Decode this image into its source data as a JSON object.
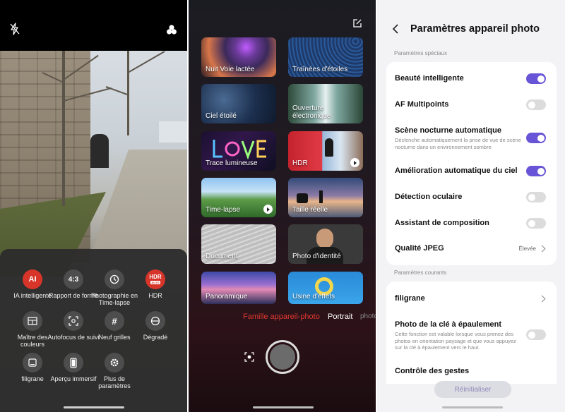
{
  "camera": {
    "icons": {
      "flash": "flash-off-icon",
      "effects": "filter-effects-icon"
    },
    "options": [
      {
        "id": "ai",
        "icon_text": "AI",
        "label": "IA intelligente",
        "active": true
      },
      {
        "id": "ratio",
        "icon_text": "4:3",
        "label": "Rapport de forme",
        "active": false
      },
      {
        "id": "timelapse",
        "icon_text": "",
        "label": "Photographie en Time-lapse",
        "active": false
      },
      {
        "id": "hdr",
        "icon_text": "HDR",
        "label": "HDR",
        "active": true,
        "badge": "AUTO"
      },
      {
        "id": "color",
        "icon_text": "",
        "label": "Maître des couleurs",
        "active": false
      },
      {
        "id": "af",
        "icon_text": "",
        "label": "Autofocus de suivi",
        "active": false
      },
      {
        "id": "grid",
        "icon_text": "",
        "label": "Neuf grilles",
        "active": false
      },
      {
        "id": "gradient",
        "icon_text": "",
        "label": "Dégradé",
        "active": false
      },
      {
        "id": "watermark",
        "icon_text": "",
        "label": "filigrane",
        "active": false
      },
      {
        "id": "preview",
        "icon_text": "",
        "label": "Aperçu immersif",
        "active": false
      },
      {
        "id": "more",
        "icon_text": "",
        "label": "Plus de paramètres",
        "active": false
      }
    ]
  },
  "modes": {
    "tiles": [
      {
        "label": "Nuit Voie lactée",
        "video": false
      },
      {
        "label": "Traînées d'étoiles",
        "video": false
      },
      {
        "label": "Ciel étoilé",
        "video": false
      },
      {
        "label": "Ouverture électronique",
        "video": false
      },
      {
        "label": "Trace lumineuse",
        "video": false
      },
      {
        "label": "HDR",
        "video": true
      },
      {
        "label": "Time-lapse",
        "video": true
      },
      {
        "label": "Taille réelle",
        "video": false
      },
      {
        "label": "Document",
        "video": false
      },
      {
        "label": "Photo d'identité",
        "video": false
      },
      {
        "label": "Panoramique",
        "video": false
      },
      {
        "label": "Usine d'effets",
        "video": false
      }
    ],
    "mode_bar": {
      "active": "Famille appareil-photo",
      "next": "Portrait",
      "partial": "photo"
    },
    "colors": {
      "active_mode": "#e0382f"
    }
  },
  "settings": {
    "title": "Paramètres appareil photo",
    "section_special": "Paramètres spéciaux",
    "section_common": "Paramètres courants",
    "special": [
      {
        "title": "Beauté intelligente",
        "desc": "",
        "type": "toggle",
        "on": true
      },
      {
        "title": "AF Multipoints",
        "desc": "",
        "type": "toggle",
        "on": false
      },
      {
        "title": "Scène nocturne automatique",
        "desc": "Déclenche automatiquement la prise de vue de scène nocturne dans un environnement sombre",
        "type": "toggle",
        "on": true
      },
      {
        "title": "Amélioration automatique du ciel",
        "desc": "",
        "type": "toggle",
        "on": true
      },
      {
        "title": "Détection oculaire",
        "desc": "",
        "type": "toggle",
        "on": false
      },
      {
        "title": "Assistant de composition",
        "desc": "",
        "type": "toggle",
        "on": false
      },
      {
        "title": "Qualité JPEG",
        "desc": "",
        "type": "value",
        "value": "Élevée"
      }
    ],
    "common": [
      {
        "title": "filigrane",
        "desc": "",
        "type": "link"
      },
      {
        "title": "Photo de la clé à épaulement",
        "desc": "Cette fonction est valable lorsque vous prenez des photos en orientation paysage et que vous appuyez sur la clé à épaulement vers le haut.",
        "type": "toggle",
        "on": false
      },
      {
        "title": "Contrôle des gestes",
        "desc": "",
        "type": "link"
      }
    ],
    "reset_label": "Réinitialiser",
    "colors": {
      "accent": "#6754d6"
    }
  }
}
